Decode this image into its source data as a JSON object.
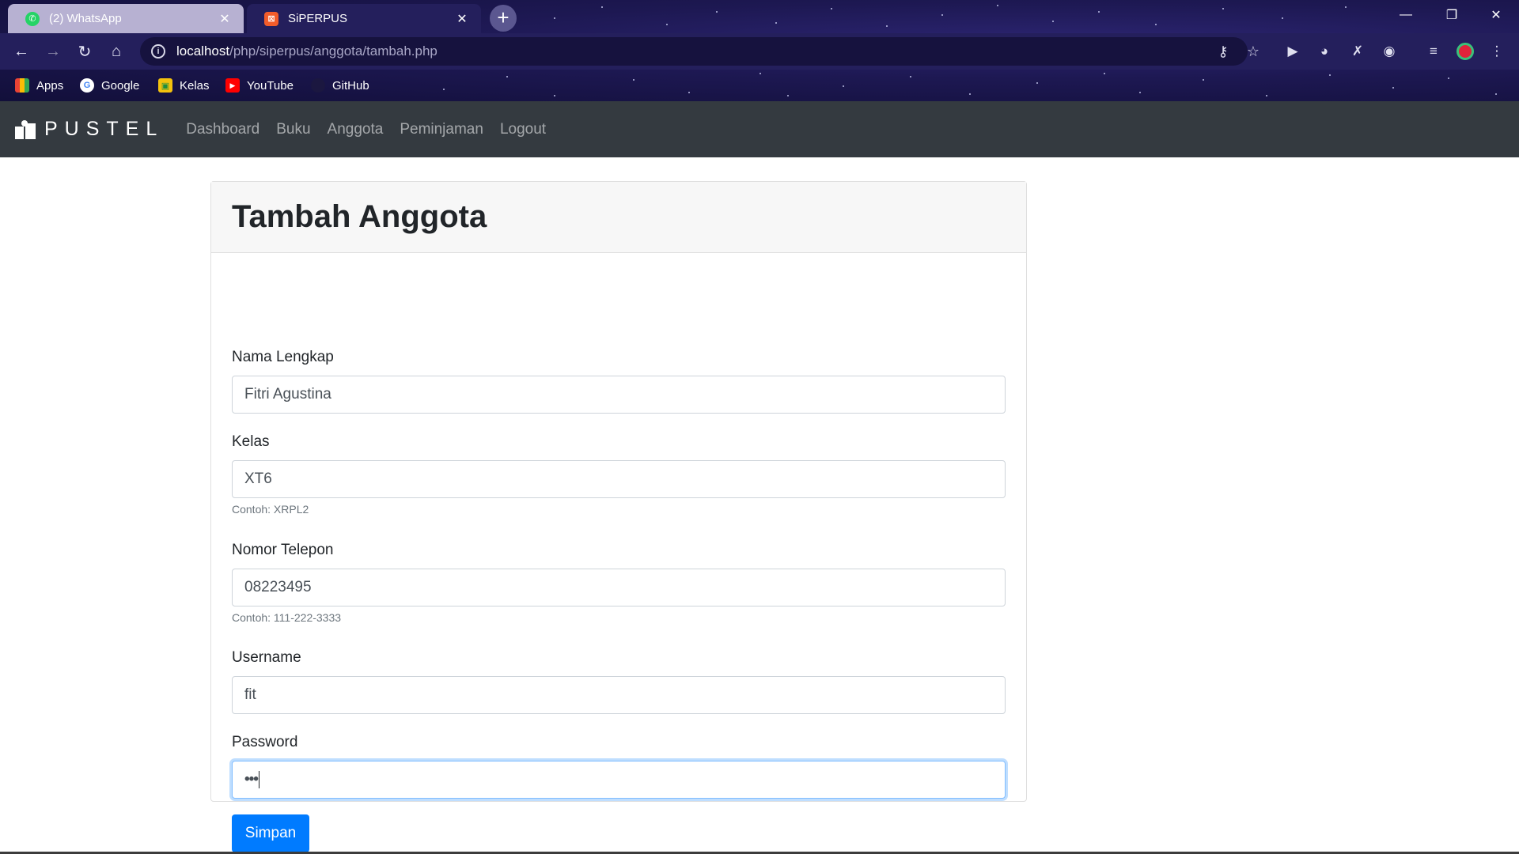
{
  "browser": {
    "tabs": [
      {
        "title": "(2) WhatsApp",
        "icon": "whatsapp-icon"
      },
      {
        "title": "SiPERPUS",
        "icon": "xampp-icon"
      }
    ],
    "url_host": "localhost",
    "url_path": "/php/siperpus/anggota/tambah.php",
    "bookmarks": [
      {
        "label": "Apps",
        "icon": "apps-grid-icon"
      },
      {
        "label": "Google",
        "icon": "google-icon"
      },
      {
        "label": "Kelas",
        "icon": "classroom-icon"
      },
      {
        "label": "YouTube",
        "icon": "youtube-icon"
      },
      {
        "label": "GitHub",
        "icon": "github-icon"
      }
    ]
  },
  "navbar": {
    "brand": "PUSTEL",
    "links": [
      "Dashboard",
      "Buku",
      "Anggota",
      "Peminjaman",
      "Logout"
    ]
  },
  "form": {
    "title": "Tambah Anggota",
    "nama": {
      "label": "Nama Lengkap",
      "value": "Fitri Agustina"
    },
    "kelas": {
      "label": "Kelas",
      "value": "XT6",
      "hint": "Contoh: XRPL2"
    },
    "telepon": {
      "label": "Nomor Telepon",
      "value": "08223495",
      "hint": "Contoh: 111-222-3333"
    },
    "username": {
      "label": "Username",
      "value": "fit"
    },
    "password": {
      "label": "Password",
      "masked_value": "•••"
    },
    "submit_label": "Simpan"
  },
  "colors": {
    "navbar_bg": "#343a40",
    "primary": "#007bff",
    "chrome_bg": "#241f5c"
  }
}
